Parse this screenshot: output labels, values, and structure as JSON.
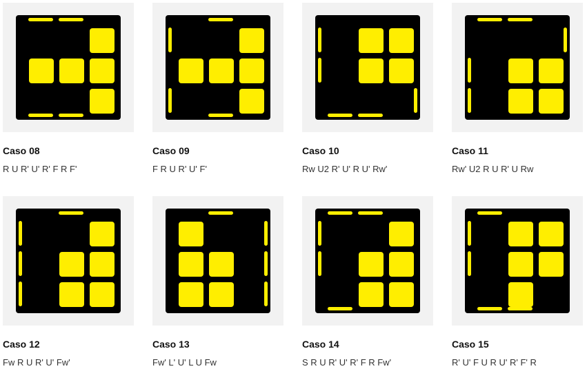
{
  "colors": {
    "sticker": "#ffee00",
    "cube": "#000000",
    "thumb_bg": "#f2f2f2"
  },
  "cases": [
    {
      "title": "Caso 08",
      "alg": "R U R' U' R' F R F'",
      "top": [
        0,
        1,
        0,
        0,
        0,
        0,
        1,
        1,
        0,
        1,
        1,
        0,
        0,
        1,
        0,
        0
      ],
      "edges": {
        "top": [
          1,
          1,
          0
        ],
        "bottom": [
          1,
          1,
          0
        ],
        "left": [
          0,
          0,
          0
        ],
        "right": [
          0,
          0,
          0
        ]
      }
    }
  ]
}
